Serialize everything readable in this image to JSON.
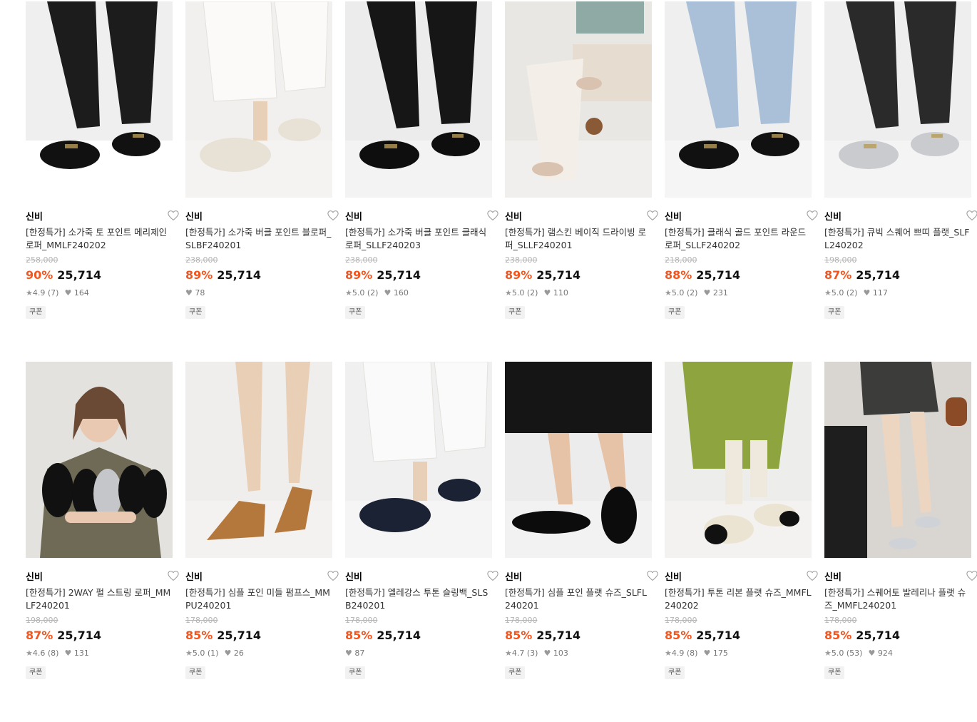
{
  "products": [
    {
      "brand": "신비",
      "title": "[한정특가] 소가죽 토 포인트 메리제인 로퍼_MMLF240202",
      "original_price": "258,000",
      "discount": "90%",
      "price": "25,714",
      "rating": "4.9 (7)",
      "likes": "164",
      "coupon": "쿠폰",
      "image": {
        "bg": "#efefef",
        "floor": "#ffffff",
        "pants": "#1c1c1c",
        "shoe": "#111111",
        "style": "black-pants"
      }
    },
    {
      "brand": "신비",
      "title": "[한정특가] 소가죽 버클 포인트 블로퍼_SLBF240201",
      "original_price": "238,000",
      "discount": "89%",
      "price": "25,714",
      "rating": "",
      "likes": "78",
      "coupon": "쿠폰",
      "image": {
        "bg": "#f1f0ee",
        "floor": "#f4f3f1",
        "pants": "#fbfaf8",
        "shoe": "#e8e1d6",
        "style": "white-pants"
      }
    },
    {
      "brand": "신비",
      "title": "[한정특가] 소가죽 버클 포인트 클래식 로퍼_SLLF240203",
      "original_price": "238,000",
      "discount": "89%",
      "price": "25,714",
      "rating": "5.0 (2)",
      "likes": "160",
      "coupon": "쿠폰",
      "image": {
        "bg": "#ececec",
        "floor": "#f3f3f3",
        "pants": "#161616",
        "shoe": "#0e0e0e",
        "style": "black-pants"
      }
    },
    {
      "brand": "신비",
      "title": "[한정특가] 램스킨 베이직 드라이빙 로퍼_SLLF240201",
      "original_price": "238,000",
      "discount": "89%",
      "price": "25,714",
      "rating": "5.0 (2)",
      "likes": "110",
      "coupon": "쿠폰",
      "image": {
        "bg": "#e9e7e4",
        "floor": "#f0efed",
        "pants": "#f3efe8",
        "shoe": "#d9c2b0",
        "style": "seated"
      }
    },
    {
      "brand": "신비",
      "title": "[한정특가] 클래식 골드 포인트 라운드 로퍼_SLLF240202",
      "original_price": "218,000",
      "discount": "88%",
      "price": "25,714",
      "rating": "5.0 (2)",
      "likes": "231",
      "coupon": "쿠폰",
      "image": {
        "bg": "#efefef",
        "floor": "#f5f5f5",
        "pants": "#a9c0d8",
        "shoe": "#111111",
        "style": "jeans"
      }
    },
    {
      "brand": "신비",
      "title": "[한정특가] 큐빅 스퀘어 쁘띠 플랫_SLFL240202",
      "original_price": "198,000",
      "discount": "87%",
      "price": "25,714",
      "rating": "5.0 (2)",
      "likes": "117",
      "coupon": "쿠폰",
      "image": {
        "bg": "#eeeeee",
        "floor": "#f4f4f4",
        "pants": "#2a2a2a",
        "shoe": "#c9cbcf",
        "style": "black-pants"
      }
    },
    {
      "brand": "신비",
      "title": "[한정특가] 2WAY 펄 스트링 로퍼_MMLF240201",
      "original_price": "198,000",
      "discount": "87%",
      "price": "25,714",
      "rating": "4.6 (8)",
      "likes": "131",
      "coupon": "쿠폰",
      "image": {
        "bg": "#e4e2df",
        "floor": "#e4e2df",
        "pants": "#6f6a55",
        "shoe": "#111111",
        "style": "model"
      }
    },
    {
      "brand": "신비",
      "title": "[한정특가] 심플 포인 미들 펌프스_MMPU240201",
      "original_price": "178,000",
      "discount": "85%",
      "price": "25,714",
      "rating": "5.0 (1)",
      "likes": "26",
      "coupon": "쿠폰",
      "image": {
        "bg": "#efeeec",
        "floor": "#f3f2f0",
        "pants": "#e9cfb5",
        "shoe": "#b5783c",
        "style": "legs"
      }
    },
    {
      "brand": "신비",
      "title": "[한정특가] 엘레강스 투톤 슬링백_SLSB240201",
      "original_price": "178,000",
      "discount": "85%",
      "price": "25,714",
      "rating": "",
      "likes": "87",
      "coupon": "쿠폰",
      "image": {
        "bg": "#f0f0f0",
        "floor": "#f5f5f5",
        "pants": "#fafafa",
        "shoe": "#1b2233",
        "style": "white-pants"
      }
    },
    {
      "brand": "신비",
      "title": "[한정특가] 심플 포인 플랫 슈즈_SLFL240201",
      "original_price": "178,000",
      "discount": "85%",
      "price": "25,714",
      "rating": "4.7 (3)",
      "likes": "103",
      "coupon": "쿠폰",
      "image": {
        "bg": "#ececec",
        "floor": "#f2f2f2",
        "pants": "#151515",
        "shoe": "#0c0c0c",
        "style": "skirt-legs"
      }
    },
    {
      "brand": "신비",
      "title": "[한정특가] 투톤 리본 플랫 슈즈_MMFL240202",
      "original_price": "178,000",
      "discount": "85%",
      "price": "25,714",
      "rating": "4.9 (8)",
      "likes": "175",
      "coupon": "쿠폰",
      "image": {
        "bg": "#ededeb",
        "floor": "#f3f2f0",
        "pants": "#8ea43f",
        "shoe": "#ece4d2",
        "style": "green-dress"
      }
    },
    {
      "brand": "신비",
      "title": "[한정특가] 스퀘어토 발레리나 플랫 슈즈_MMFL240201",
      "original_price": "178,000",
      "discount": "85%",
      "price": "25,714",
      "rating": "5.0 (53)",
      "likes": "924",
      "coupon": "쿠폰",
      "image": {
        "bg": "#d9d6d2",
        "floor": "#2b2b2b",
        "pants": "#3c3c3a",
        "shoe": "#cfd2d6",
        "style": "stairs"
      }
    }
  ]
}
